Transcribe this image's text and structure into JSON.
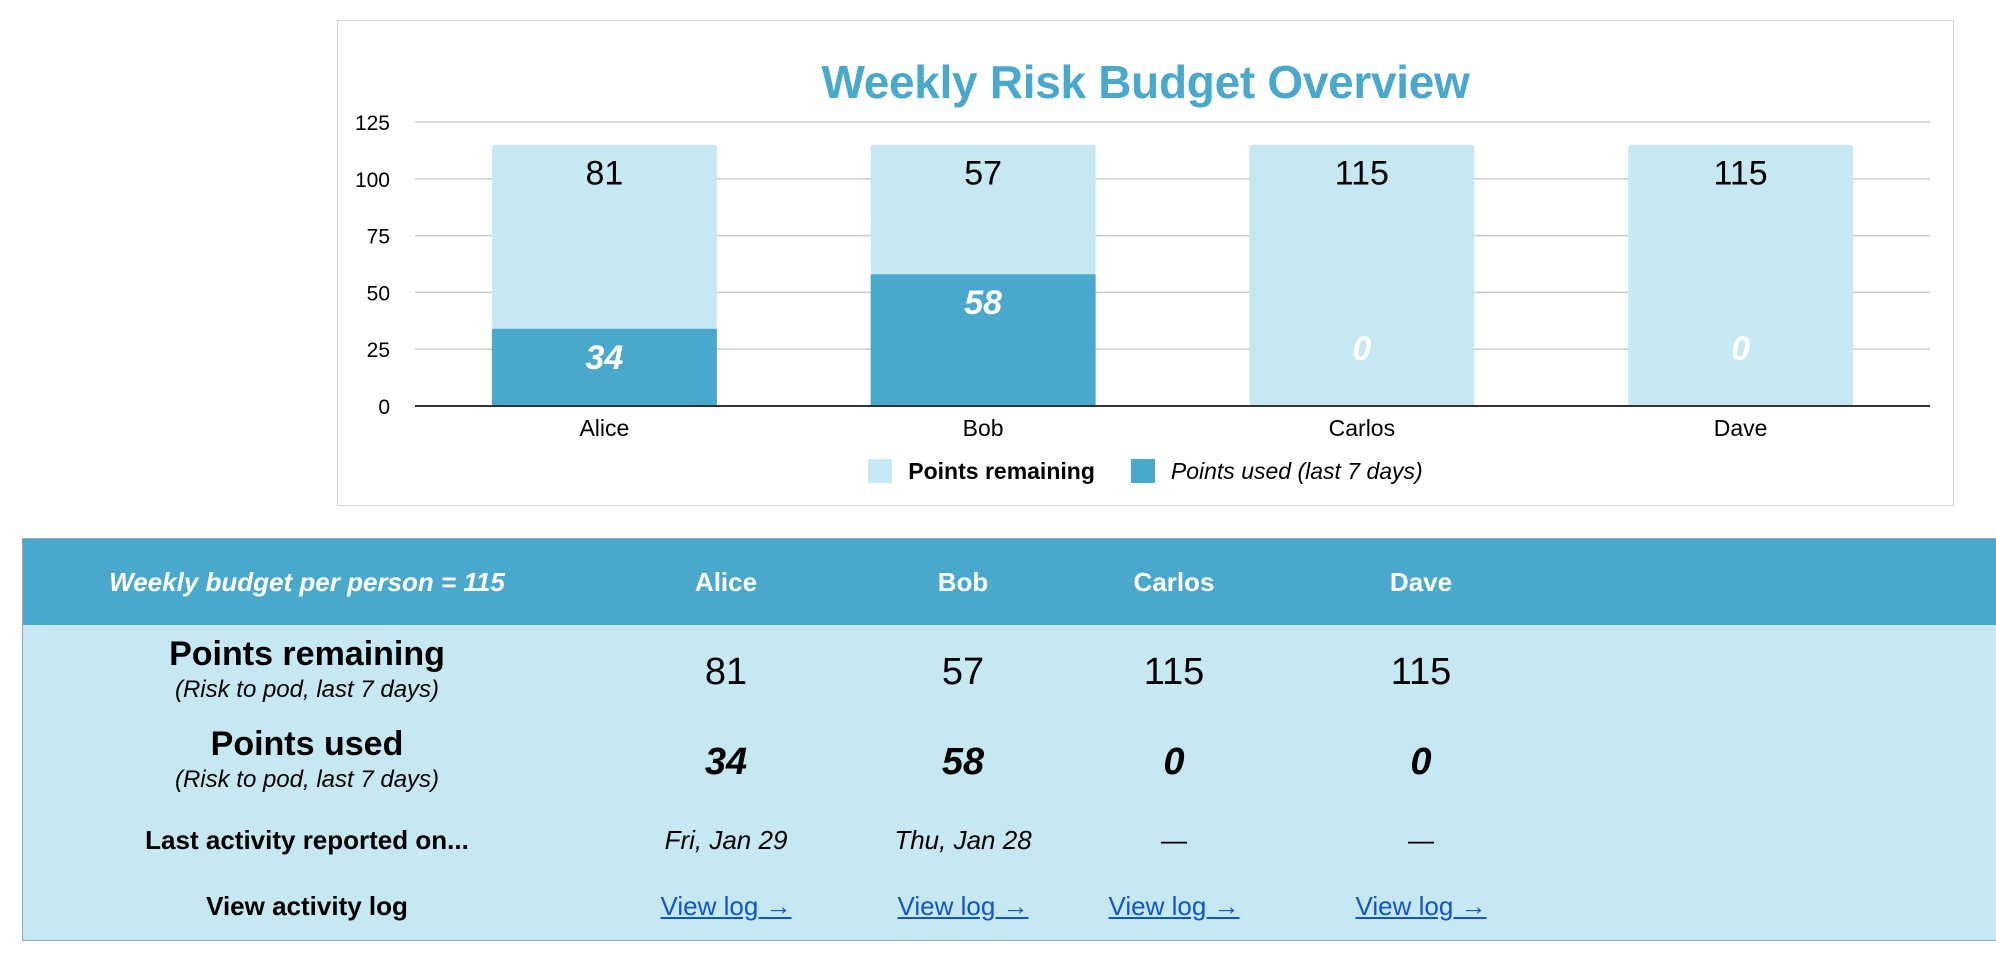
{
  "chart": {
    "title": "Weekly Risk Budget Overview",
    "legend": [
      {
        "label": "Points remaining",
        "color": "#c5e8f2"
      },
      {
        "label": "Points used (last 7 days)",
        "color": "#4aa8cd"
      }
    ]
  },
  "chart_data": {
    "type": "bar",
    "stacked": true,
    "title": "Weekly Risk Budget Overview",
    "categories": [
      "Alice",
      "Bob",
      "Carlos",
      "Dave"
    ],
    "series": [
      {
        "name": "Points used (last 7 days)",
        "values": [
          34,
          58,
          0,
          0
        ],
        "color": "#4aa8cd"
      },
      {
        "name": "Points remaining",
        "values": [
          81,
          57,
          115,
          115
        ],
        "color": "#c5e8f2"
      }
    ],
    "y_ticks": [
      0,
      25,
      50,
      75,
      100,
      125
    ],
    "ylim": [
      0,
      125
    ],
    "grid": true,
    "legend_position": "bottom"
  },
  "table": {
    "header_budget": "Weekly budget per person = 115",
    "people": [
      "Alice",
      "Bob",
      "Carlos",
      "Dave"
    ],
    "rows": {
      "remaining_label": "Points remaining",
      "remaining_sub": "(Risk to pod, last 7 days)",
      "remaining": [
        "81",
        "57",
        "115",
        "115"
      ],
      "used_label": "Points used",
      "used_sub": "(Risk to pod, last 7 days)",
      "used": [
        "34",
        "58",
        "0",
        "0"
      ],
      "activity_label": "Last activity reported on...",
      "activity": [
        "Fri, Jan 29",
        "Thu, Jan 28",
        "—",
        "—"
      ],
      "log_label": "View activity log",
      "log_link": "View log →"
    }
  }
}
